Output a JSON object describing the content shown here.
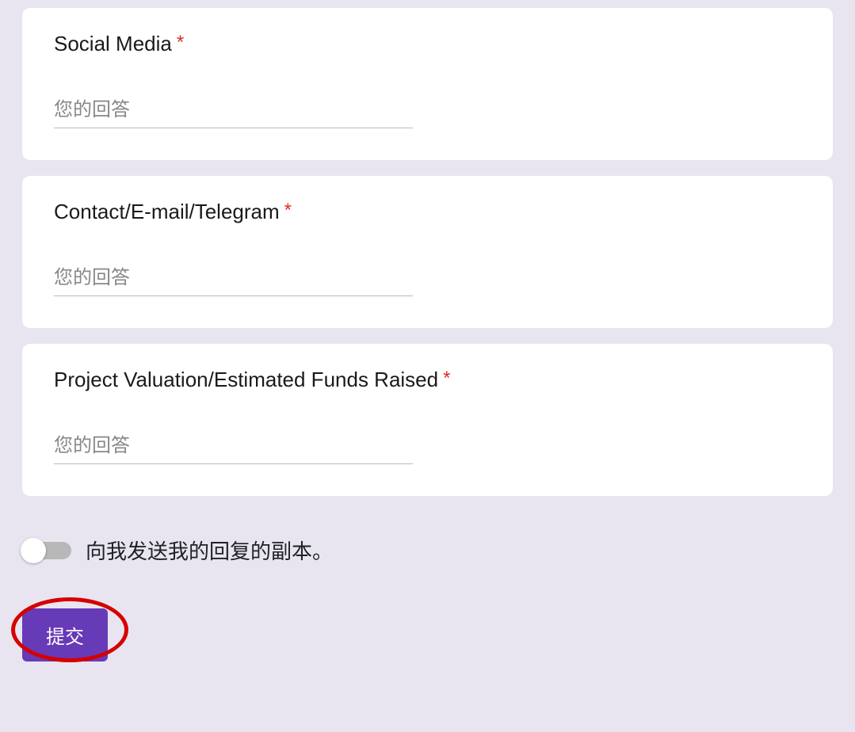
{
  "questions": [
    {
      "label": "Social Media",
      "required": true,
      "placeholder": "您的回答"
    },
    {
      "label": "Contact/E-mail/Telegram",
      "required": true,
      "placeholder": "您的回答"
    },
    {
      "label": "Project Valuation/Estimated Funds Raised",
      "required": true,
      "placeholder": "您的回答"
    }
  ],
  "toggle": {
    "label": "向我发送我的回复的副本。"
  },
  "submit": {
    "label": "提交"
  },
  "required_symbol": "*"
}
